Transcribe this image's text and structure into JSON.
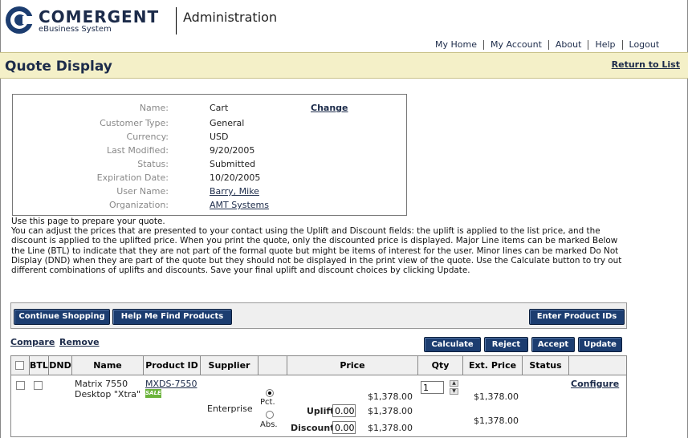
{
  "brand": {
    "name": "COMERGENT",
    "subtitle": "eBusiness System"
  },
  "header": {
    "section": "Administration"
  },
  "topnav": [
    "My Home",
    "My Account",
    "About",
    "Help",
    "Logout"
  ],
  "page": {
    "title": "Quote Display",
    "return_link": "Return to List"
  },
  "quote": {
    "rows": [
      {
        "label": "Name:",
        "value": "Cart"
      },
      {
        "label": "Customer Type:",
        "value": "General"
      },
      {
        "label": "Currency:",
        "value": "USD"
      },
      {
        "label": "Last Modified:",
        "value": "9/20/2005"
      },
      {
        "label": "Status:",
        "value": "Submitted"
      },
      {
        "label": "Expiration Date:",
        "value": "10/20/2005"
      },
      {
        "label": "User Name:",
        "value": "Barry, Mike"
      },
      {
        "label": "Organization:",
        "value": "AMT Systems"
      }
    ],
    "change_label": "Change"
  },
  "instructions": {
    "line1": "Use this page to prepare your quote.",
    "body": "You can adjust the prices that are presented to your contact using the Uplift and Discount fields: the uplift is applied to the list price, and the discount is applied to the uplifted price. When you print the quote, only the discounted price is displayed. Major Line items can be marked Below the Line (BTL) to indicate that they are not part of the formal quote but might be items of interest for the user. Minor lines can be marked Do Not Display (DND) when they are part of the quote but they should not be displayed in the print view of the quote. Use the Calculate button to try out different combinations of uplifts and discounts. Save your final uplift and discount choices by clicking Update."
  },
  "actions": {
    "continue_shopping": "Continue Shopping",
    "help_find": "Help Me Find Products",
    "enter_ids": "Enter Product IDs",
    "compare": "Compare",
    "remove": "Remove",
    "calculate": "Calculate",
    "reject": "Reject",
    "accept": "Accept",
    "update": "Update"
  },
  "table": {
    "headers": [
      "BTL",
      "DND",
      "Name",
      "Product ID",
      "Supplier",
      "Price",
      "Qty",
      "Ext. Price",
      "Status"
    ],
    "row": {
      "name_line1": "Matrix 7550",
      "name_line2": "Desktop \"Xtra\"",
      "product_id": "MXDS-7550",
      "sale_badge": "SALE",
      "supplier": "Enterprise",
      "pct_label": "Pct.",
      "abs_label": "Abs.",
      "price": "$1,378.00",
      "uplift_label": "Uplift",
      "uplift_value": "0.00",
      "uplift_price": "$1,378.00",
      "discount_label": "Discount",
      "discount_value": "0.00",
      "discount_price": "$1,378.00",
      "qty": "1",
      "ext_price": "$1,378.00",
      "ext_price_2": "$1,378.00",
      "configure": "Configure"
    }
  },
  "colors": {
    "brand": "#1c2b4a",
    "button": "#1c3d70",
    "titlebar": "#f4f0c8"
  }
}
